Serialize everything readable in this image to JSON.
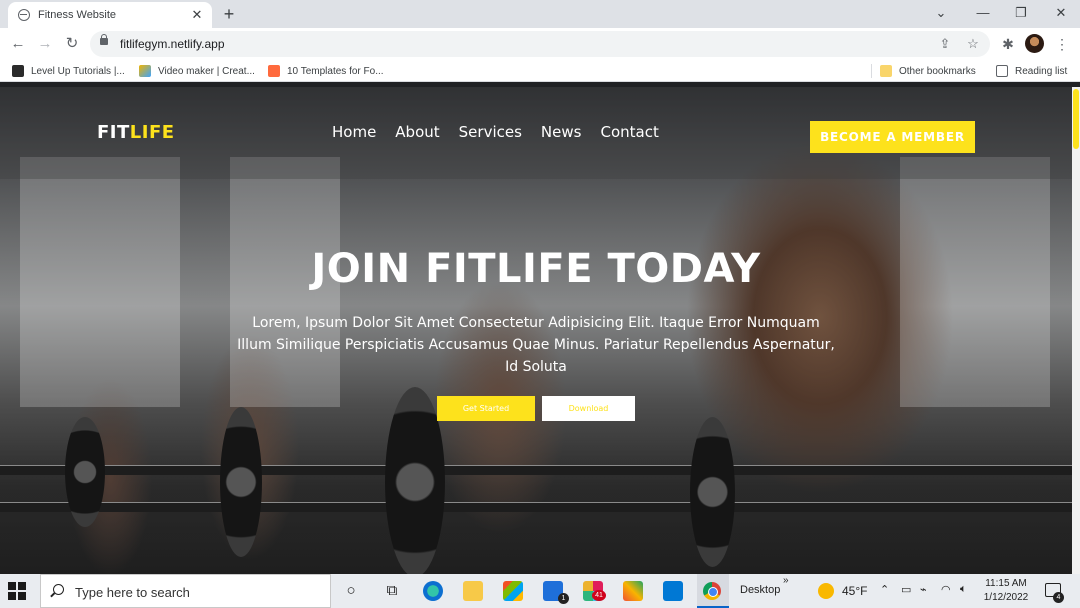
{
  "browser": {
    "tab_title": "Fitness Website",
    "tab_close": "✕",
    "new_tab": "+",
    "controls": {
      "chevron": "⌄",
      "minimize": "—",
      "restore": "❐",
      "close": "✕"
    },
    "nav": {
      "back": "←",
      "forward": "→",
      "reload": "↻"
    },
    "url": "fitlifegym.netlify.app",
    "bookmarks": [
      {
        "label": "Level Up Tutorials |...",
        "color": "#2b2b2b"
      },
      {
        "label": "Video maker | Creat...",
        "color": "#f0b400"
      },
      {
        "label": "10 Templates for Fo...",
        "color": "#ff6a3d"
      }
    ],
    "other_bookmarks": "Other bookmarks",
    "reading_list": "Reading list"
  },
  "site": {
    "logo": {
      "part1": "FIT",
      "part2": "LIFE"
    },
    "menu": [
      "Home",
      "About",
      "Services",
      "News",
      "Contact"
    ],
    "cta": "BECOME A MEMBER",
    "hero": {
      "title": "JOIN FITLIFE TODAY",
      "text": "Lorem, Ipsum Dolor Sit Amet Consectetur Adipisicing Elit. Itaque Error Numquam Illum Similique Perspiciatis Accusamus Quae Minus. Pariatur Repellendus Aspernatur, Id Soluta",
      "primary_button": "Get Started",
      "secondary_button": "Download"
    },
    "accent_color": "#fde21c"
  },
  "taskbar": {
    "search_placeholder": "Type here to search",
    "mail_badge": "1",
    "slack_badge": "41",
    "desktop_label": "Desktop",
    "more": "»",
    "temperature": "45°F",
    "time": "11:15 AM",
    "date": "1/12/2022",
    "notification_count": "4"
  }
}
